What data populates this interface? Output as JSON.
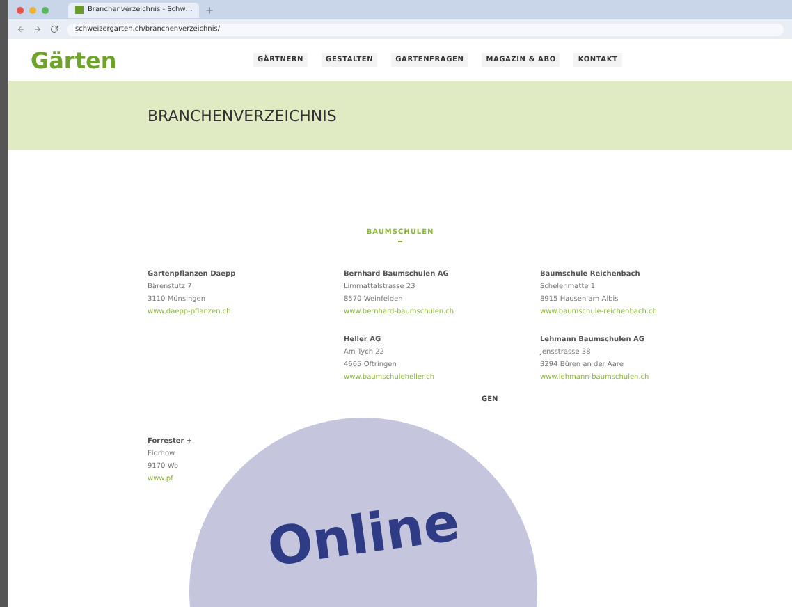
{
  "browser": {
    "tab_title": "Branchenverzeichnis - Schw…",
    "address": "schweizergarten.ch/branchenverzeichnis/"
  },
  "site": {
    "logo": "Gärten",
    "nav": [
      {
        "label": "GÄRTNERN"
      },
      {
        "label": "GESTALTEN"
      },
      {
        "label": "GARTENFRAGEN"
      },
      {
        "label": "MAGAZIN & ABO"
      },
      {
        "label": "KONTAKT"
      }
    ],
    "page_title": "BRANCHENVERZEICHNIS",
    "section_title": "BAUMSCHULEN",
    "entry_rows": [
      {
        "entries": [
          {
            "name": "Gartenpflanzen Daepp",
            "street": "Bärenstutz 7",
            "city": "3110 Münsingen",
            "url": "www.daepp-pflanzen.ch"
          },
          {
            "name": "Bernhard Baumschulen AG",
            "street": "Limmattalstrasse 23",
            "city": "8570 Weinfelden",
            "url": "www.bernhard-baumschulen.ch"
          },
          {
            "name": "Baumschule Reichenbach",
            "street": "Schelenmatte 1",
            "city": "8915 Hausen am Albis",
            "url": "www.baumschule-reichenbach.ch"
          }
        ]
      },
      {
        "entries": [
          {
            "name": "Heller AG",
            "street": "Am Tych 22",
            "city": "4665 Oftringen",
            "url": "www.baumschuleheller.ch"
          },
          {
            "name": "Lehmann Baumschulen AG",
            "street": "Jensstrasse 38",
            "city": "3294 Büren an der Aare",
            "url": "www.lehmann-baumschulen.ch"
          }
        ]
      }
    ],
    "next_section_fragment": "GEN",
    "partial_entry": {
      "name": "Forrester +",
      "street": "Florhow",
      "city": "9170 Wo",
      "url": "www.pf"
    }
  },
  "badge": {
    "text": "Online"
  }
}
